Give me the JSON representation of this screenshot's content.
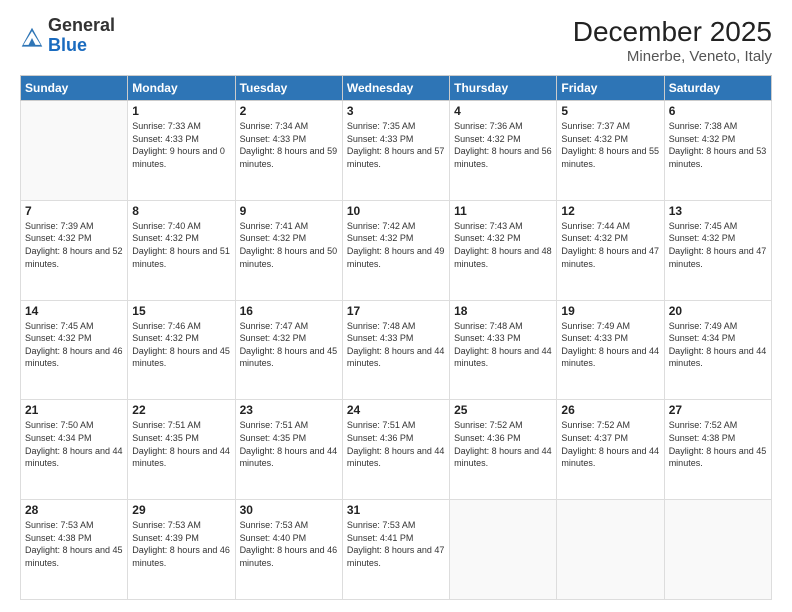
{
  "header": {
    "logo": {
      "general": "General",
      "blue": "Blue"
    },
    "title": "December 2025",
    "subtitle": "Minerbe, Veneto, Italy"
  },
  "weekdays": [
    "Sunday",
    "Monday",
    "Tuesday",
    "Wednesday",
    "Thursday",
    "Friday",
    "Saturday"
  ],
  "weeks": [
    [
      {
        "day": "",
        "sunrise": "",
        "sunset": "",
        "daylight": ""
      },
      {
        "day": "1",
        "sunrise": "Sunrise: 7:33 AM",
        "sunset": "Sunset: 4:33 PM",
        "daylight": "Daylight: 9 hours and 0 minutes."
      },
      {
        "day": "2",
        "sunrise": "Sunrise: 7:34 AM",
        "sunset": "Sunset: 4:33 PM",
        "daylight": "Daylight: 8 hours and 59 minutes."
      },
      {
        "day": "3",
        "sunrise": "Sunrise: 7:35 AM",
        "sunset": "Sunset: 4:33 PM",
        "daylight": "Daylight: 8 hours and 57 minutes."
      },
      {
        "day": "4",
        "sunrise": "Sunrise: 7:36 AM",
        "sunset": "Sunset: 4:32 PM",
        "daylight": "Daylight: 8 hours and 56 minutes."
      },
      {
        "day": "5",
        "sunrise": "Sunrise: 7:37 AM",
        "sunset": "Sunset: 4:32 PM",
        "daylight": "Daylight: 8 hours and 55 minutes."
      },
      {
        "day": "6",
        "sunrise": "Sunrise: 7:38 AM",
        "sunset": "Sunset: 4:32 PM",
        "daylight": "Daylight: 8 hours and 53 minutes."
      }
    ],
    [
      {
        "day": "7",
        "sunrise": "Sunrise: 7:39 AM",
        "sunset": "Sunset: 4:32 PM",
        "daylight": "Daylight: 8 hours and 52 minutes."
      },
      {
        "day": "8",
        "sunrise": "Sunrise: 7:40 AM",
        "sunset": "Sunset: 4:32 PM",
        "daylight": "Daylight: 8 hours and 51 minutes."
      },
      {
        "day": "9",
        "sunrise": "Sunrise: 7:41 AM",
        "sunset": "Sunset: 4:32 PM",
        "daylight": "Daylight: 8 hours and 50 minutes."
      },
      {
        "day": "10",
        "sunrise": "Sunrise: 7:42 AM",
        "sunset": "Sunset: 4:32 PM",
        "daylight": "Daylight: 8 hours and 49 minutes."
      },
      {
        "day": "11",
        "sunrise": "Sunrise: 7:43 AM",
        "sunset": "Sunset: 4:32 PM",
        "daylight": "Daylight: 8 hours and 48 minutes."
      },
      {
        "day": "12",
        "sunrise": "Sunrise: 7:44 AM",
        "sunset": "Sunset: 4:32 PM",
        "daylight": "Daylight: 8 hours and 47 minutes."
      },
      {
        "day": "13",
        "sunrise": "Sunrise: 7:45 AM",
        "sunset": "Sunset: 4:32 PM",
        "daylight": "Daylight: 8 hours and 47 minutes."
      }
    ],
    [
      {
        "day": "14",
        "sunrise": "Sunrise: 7:45 AM",
        "sunset": "Sunset: 4:32 PM",
        "daylight": "Daylight: 8 hours and 46 minutes."
      },
      {
        "day": "15",
        "sunrise": "Sunrise: 7:46 AM",
        "sunset": "Sunset: 4:32 PM",
        "daylight": "Daylight: 8 hours and 45 minutes."
      },
      {
        "day": "16",
        "sunrise": "Sunrise: 7:47 AM",
        "sunset": "Sunset: 4:32 PM",
        "daylight": "Daylight: 8 hours and 45 minutes."
      },
      {
        "day": "17",
        "sunrise": "Sunrise: 7:48 AM",
        "sunset": "Sunset: 4:33 PM",
        "daylight": "Daylight: 8 hours and 44 minutes."
      },
      {
        "day": "18",
        "sunrise": "Sunrise: 7:48 AM",
        "sunset": "Sunset: 4:33 PM",
        "daylight": "Daylight: 8 hours and 44 minutes."
      },
      {
        "day": "19",
        "sunrise": "Sunrise: 7:49 AM",
        "sunset": "Sunset: 4:33 PM",
        "daylight": "Daylight: 8 hours and 44 minutes."
      },
      {
        "day": "20",
        "sunrise": "Sunrise: 7:49 AM",
        "sunset": "Sunset: 4:34 PM",
        "daylight": "Daylight: 8 hours and 44 minutes."
      }
    ],
    [
      {
        "day": "21",
        "sunrise": "Sunrise: 7:50 AM",
        "sunset": "Sunset: 4:34 PM",
        "daylight": "Daylight: 8 hours and 44 minutes."
      },
      {
        "day": "22",
        "sunrise": "Sunrise: 7:51 AM",
        "sunset": "Sunset: 4:35 PM",
        "daylight": "Daylight: 8 hours and 44 minutes."
      },
      {
        "day": "23",
        "sunrise": "Sunrise: 7:51 AM",
        "sunset": "Sunset: 4:35 PM",
        "daylight": "Daylight: 8 hours and 44 minutes."
      },
      {
        "day": "24",
        "sunrise": "Sunrise: 7:51 AM",
        "sunset": "Sunset: 4:36 PM",
        "daylight": "Daylight: 8 hours and 44 minutes."
      },
      {
        "day": "25",
        "sunrise": "Sunrise: 7:52 AM",
        "sunset": "Sunset: 4:36 PM",
        "daylight": "Daylight: 8 hours and 44 minutes."
      },
      {
        "day": "26",
        "sunrise": "Sunrise: 7:52 AM",
        "sunset": "Sunset: 4:37 PM",
        "daylight": "Daylight: 8 hours and 44 minutes."
      },
      {
        "day": "27",
        "sunrise": "Sunrise: 7:52 AM",
        "sunset": "Sunset: 4:38 PM",
        "daylight": "Daylight: 8 hours and 45 minutes."
      }
    ],
    [
      {
        "day": "28",
        "sunrise": "Sunrise: 7:53 AM",
        "sunset": "Sunset: 4:38 PM",
        "daylight": "Daylight: 8 hours and 45 minutes."
      },
      {
        "day": "29",
        "sunrise": "Sunrise: 7:53 AM",
        "sunset": "Sunset: 4:39 PM",
        "daylight": "Daylight: 8 hours and 46 minutes."
      },
      {
        "day": "30",
        "sunrise": "Sunrise: 7:53 AM",
        "sunset": "Sunset: 4:40 PM",
        "daylight": "Daylight: 8 hours and 46 minutes."
      },
      {
        "day": "31",
        "sunrise": "Sunrise: 7:53 AM",
        "sunset": "Sunset: 4:41 PM",
        "daylight": "Daylight: 8 hours and 47 minutes."
      },
      {
        "day": "",
        "sunrise": "",
        "sunset": "",
        "daylight": ""
      },
      {
        "day": "",
        "sunrise": "",
        "sunset": "",
        "daylight": ""
      },
      {
        "day": "",
        "sunrise": "",
        "sunset": "",
        "daylight": ""
      }
    ]
  ]
}
